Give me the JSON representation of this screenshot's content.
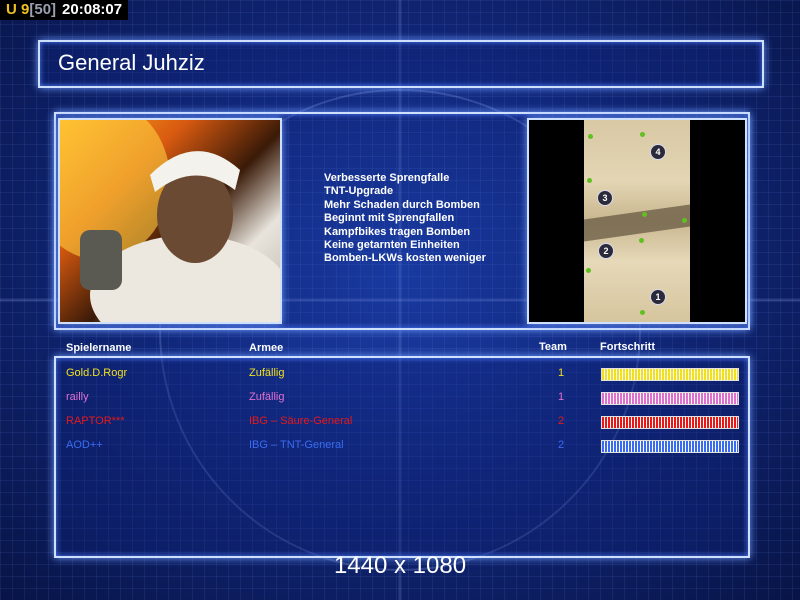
{
  "hud": {
    "unit_prefix": "U",
    "unit_count": "9",
    "unit_cap": "[50]",
    "clock": "20:08:07"
  },
  "title": "General Juhziz",
  "traits": [
    "Verbesserte Sprengfalle",
    "TNT-Upgrade",
    "Mehr Schaden durch Bomben",
    "Beginnt mit Sprengfallen",
    "Kampfbikes tragen Bomben",
    "Keine getarnten Einheiten",
    "Bomben-LKWs kosten weniger"
  ],
  "minimap": {
    "spawns": [
      "4",
      "3",
      "2",
      "1"
    ]
  },
  "table": {
    "headers": {
      "player": "Spielername",
      "army": "Armee",
      "team": "Team",
      "progress": "Fortschritt"
    },
    "rows": [
      {
        "name": "Gold.D.Rogr",
        "army": "Zufällig",
        "team": "1",
        "color": "#f0e020",
        "progress": 1.0
      },
      {
        "name": "railly",
        "army": "Zufällig",
        "team": "1",
        "color": "#e070d0",
        "progress": 1.0
      },
      {
        "name": "RAPTOR***",
        "army": "IBG – Säure-General",
        "team": "2",
        "color": "#e81818",
        "progress": 1.0
      },
      {
        "name": "AOD++",
        "army": "IBG – TNT-General",
        "team": "2",
        "color": "#3a6cf0",
        "progress": 1.0
      }
    ]
  },
  "resolution": "1440 x 1080",
  "colors": {
    "frame": "#cfe0ff",
    "hud_unit": "#f0c020"
  }
}
